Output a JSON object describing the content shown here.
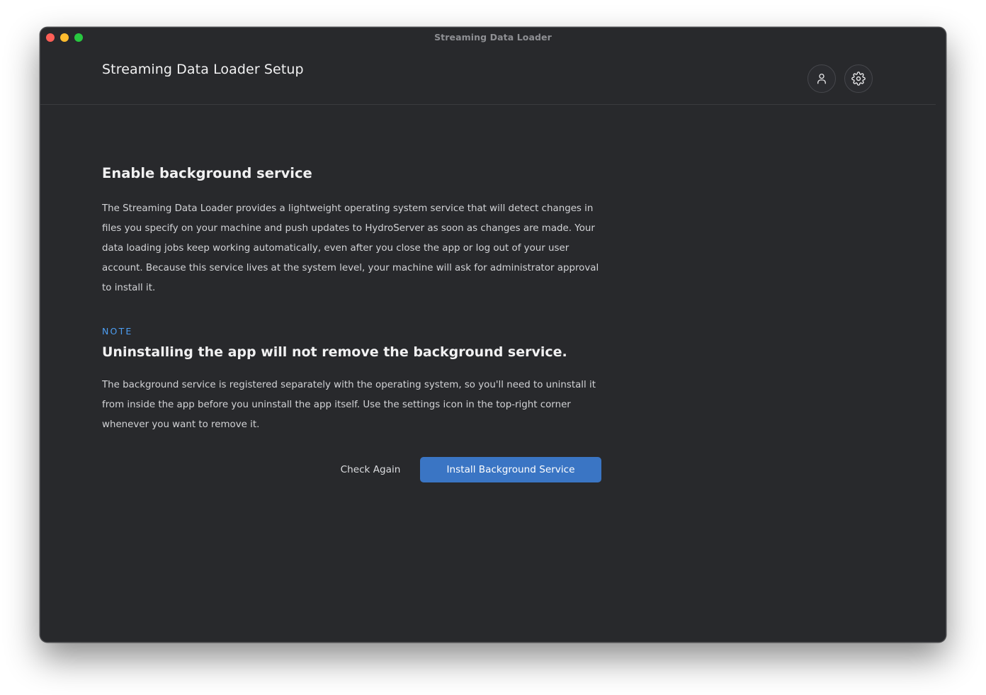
{
  "window": {
    "title": "Streaming Data Loader",
    "traffic_colors": {
      "close": "#fe5f57",
      "minimize": "#febc2e",
      "maximize": "#28c840"
    }
  },
  "header": {
    "title": "Streaming Data Loader Setup",
    "icons": [
      "user-icon",
      "gear-icon"
    ]
  },
  "main": {
    "heading": "Enable background service",
    "description": "The Streaming Data Loader provides a lightweight operating system service that will detect changes in files you specify on your machine and push updates to HydroServer as soon as changes are made. Your data loading jobs keep working automatically, even after you close the app or log out of your user account. Because this service lives at the system level, your machine will ask for administrator approval to install it.",
    "note": {
      "label": "NOTE",
      "heading": "Uninstalling the app will not remove the background service.",
      "body": "The background service is registered separately with the operating system, so you'll need to uninstall it from inside the app before you uninstall the app itself. Use the settings icon in the top-right corner whenever you want to remove it."
    }
  },
  "actions": {
    "secondary_label": "Check Again",
    "primary_label": "Install Background Service",
    "primary_color": "#3a75c4"
  }
}
